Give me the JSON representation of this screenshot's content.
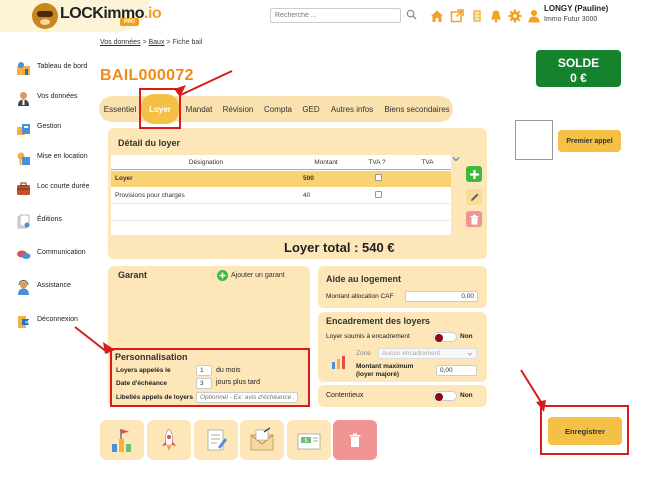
{
  "header": {
    "logo_text_main": "LOCKimmo",
    "logo_text_suffix": ".io",
    "logo_badge": "PRO",
    "search_placeholder": "Recherche ...",
    "user_name": "LONGY (Pauline)",
    "user_company": "Immo Futur 3000"
  },
  "sidebar": {
    "items": [
      {
        "label": "Tableau de bord",
        "icon": "dashboard-icon"
      },
      {
        "label": "Vos données",
        "icon": "user-data-icon"
      },
      {
        "label": "Gestion",
        "icon": "management-icon"
      },
      {
        "label": "Mise en location",
        "icon": "rental-icon"
      },
      {
        "label": "Loc courte durée",
        "icon": "suitcase-icon"
      },
      {
        "label": "Éditions",
        "icon": "documents-icon"
      },
      {
        "label": "Communication",
        "icon": "chat-icon"
      },
      {
        "label": "Assistance",
        "icon": "support-icon"
      },
      {
        "label": "Déconnexion",
        "icon": "logout-icon"
      }
    ]
  },
  "breadcrumb": {
    "item1": "Vos données",
    "sep": ">",
    "item2": "Baux",
    "item3": "Fiche bail"
  },
  "page": {
    "title": "BAIL000072"
  },
  "solde": {
    "label": "SOLDE",
    "value": "0 €"
  },
  "actions": {
    "premier_appel": "Premier appel",
    "enregistrer": "Enregistrer"
  },
  "tabs": [
    {
      "label": "Essentiel",
      "active": false
    },
    {
      "label": "Loyer",
      "active": true
    },
    {
      "label": "Mandat",
      "active": false
    },
    {
      "label": "Révision",
      "active": false
    },
    {
      "label": "Compta",
      "active": false
    },
    {
      "label": "GED",
      "active": false
    },
    {
      "label": "Autres infos",
      "active": false
    },
    {
      "label": "Biens secondaires",
      "active": false
    }
  ],
  "detail": {
    "title": "Détail du loyer",
    "columns": [
      "Désignation",
      "Montant",
      "TVA ?",
      "TVA"
    ],
    "rows": [
      {
        "designation": "Loyer",
        "montant": "500",
        "tva_checked": false,
        "tva": ""
      },
      {
        "designation": "Provisions pour charges",
        "montant": "40",
        "tva_checked": false,
        "tva": ""
      }
    ],
    "total_label": "Loyer total : 540 €"
  },
  "garant": {
    "title": "Garant",
    "add_label": "Ajouter un garant"
  },
  "personnalisation": {
    "title": "Personnalisation",
    "loyers_appeles_label": "Loyers appelés le",
    "loyers_appeles_value": "1",
    "loyers_appeles_suffix": "du mois",
    "date_echeance_label": "Date d'échéance",
    "date_echeance_value": "3",
    "date_echeance_suffix": "jours plus tard",
    "libelles_label": "Libellés appels de loyers",
    "libelles_placeholder": "Optionnel - Ex: avis d'échéance ..."
  },
  "aide_logement": {
    "title": "Aide au logement",
    "montant_caf_label": "Montant allocation CAF",
    "montant_caf_value": "0,00"
  },
  "encadrement": {
    "title": "Encadrement des loyers",
    "soumis_label": "Loyer soumis à encadrement",
    "soumis_value": "Non",
    "zone_label": "Zone",
    "zone_value": "Aucun encadrement",
    "montant_max_label": "Montant maximum (loyer majoré)",
    "montant_max_value": "0,00"
  },
  "contentieux": {
    "label": "Contentieux",
    "value": "Non"
  },
  "colors": {
    "accent": "#f4c046",
    "orange_title": "#f08a18",
    "panel": "#fde6b8",
    "solde_green": "#15832e",
    "annotation_red": "#d81c1c"
  }
}
